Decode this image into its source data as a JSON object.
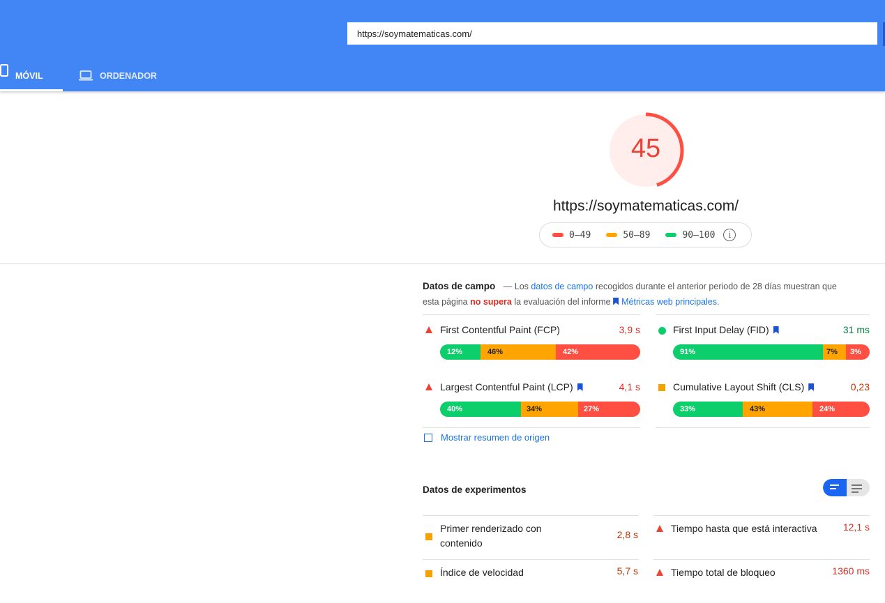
{
  "header": {
    "url_value": "https://soymatematicas.com/",
    "tabs": [
      {
        "label": "MÓVIL",
        "active": true
      },
      {
        "label": "ORDENADOR",
        "active": false
      }
    ]
  },
  "score": {
    "value": "45",
    "fraction": 0.45,
    "url": "https://soymatematicas.com/",
    "legend": [
      {
        "range": "0–49",
        "color": "#ff4e42"
      },
      {
        "range": "50–89",
        "color": "#ffa400"
      },
      {
        "range": "90–100",
        "color": "#0cce6b"
      }
    ]
  },
  "field": {
    "title": "Datos de campo",
    "desc_1": "— Los",
    "link_1": "datos de campo",
    "desc_2": "recogidos durante el anterior periodo de 28 días muestran que esta página",
    "fail": "no supera",
    "desc_3": "la evaluación del informe",
    "link_2": "Métricas web principales",
    "desc_end": ".",
    "metrics": [
      {
        "name": "First Contentful Paint (FCP)",
        "value": "3,9 s",
        "status": "fail",
        "bookmark": false,
        "dist": [
          "12%",
          "46%",
          "42%"
        ]
      },
      {
        "name": "First Input Delay (FID)",
        "value": "31 ms",
        "status": "pass",
        "bookmark": true,
        "dist": [
          "91%",
          "7%",
          "3%"
        ]
      },
      {
        "name": "Largest Contentful Paint (LCP)",
        "value": "4,1 s",
        "status": "fail",
        "bookmark": true,
        "dist": [
          "40%",
          "34%",
          "27%"
        ]
      },
      {
        "name": "Cumulative Layout Shift (CLS)",
        "value": "0,23",
        "status": "average",
        "bookmark": true,
        "dist": [
          "33%",
          "43%",
          "24%"
        ]
      }
    ],
    "origin_label": "Mostrar resumen de origen"
  },
  "lab": {
    "title": "Datos de experimentos",
    "metrics": [
      {
        "name_1": "Primer renderizado con",
        "name_2": "contenido",
        "value": "2,8 s",
        "status": "average"
      },
      {
        "name_1": "Tiempo hasta que está interactiva",
        "value": "12,1 s",
        "status": "fail"
      },
      {
        "name_1": "Índice de velocidad",
        "value": "5,7 s",
        "status": "average"
      },
      {
        "name_1": "Tiempo total de bloqueo",
        "value": "1360 ms",
        "status": "fail"
      }
    ]
  }
}
